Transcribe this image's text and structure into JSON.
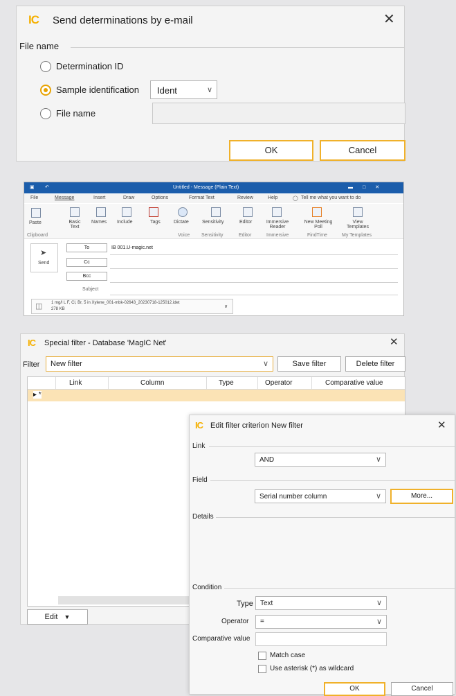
{
  "send_dialog": {
    "logo": "IC",
    "title": "Send determinations by e-mail",
    "close": "✕",
    "group_label": "File name",
    "option_determination_id": "Determination ID",
    "option_sample_identification": "Sample identification",
    "sample_select_value": "Ident",
    "option_file_name": "File name",
    "ok_label": "OK",
    "cancel_label": "Cancel"
  },
  "outlook": {
    "window_title": "Untitled - Message (Plain Text)",
    "menu": [
      "File",
      "Message",
      "Insert",
      "Draw",
      "Options",
      "Format Text",
      "Review",
      "Help"
    ],
    "tell_me": "Tell me what you want to do",
    "ribbon": {
      "paste": "Paste",
      "basic_text": "Basic Text",
      "names": "Names",
      "include": "Include",
      "tags": "Tags",
      "dictate": "Dictate",
      "sensitivity": "Sensitivity",
      "editor": "Editor",
      "immersive_reader": "Immersive Reader",
      "new_meeting_poll": "New Meeting Poll",
      "view_templates": "View Templates"
    },
    "groups": [
      "Clipboard",
      "Voice",
      "Sensitivity",
      "Editor",
      "Immersive",
      "FindTime",
      "My Templates"
    ],
    "send_label": "Send",
    "to_label": "To",
    "cc_label": "Cc",
    "bcc_label": "Bcc",
    "subject_label": "Subject",
    "to_value": "IB 001.U-magic.net",
    "attachment_name": "1 mg/l L F, Cl, Br, 5 in Xylene_001-mbk-02643_20230718-125012.idet",
    "attachment_size": "278 KB"
  },
  "special_filter": {
    "logo": "IC",
    "title": "Special filter - Database 'MagIC Net'",
    "close": "✕",
    "filter_label": "Filter",
    "filter_value": "New filter",
    "save_filter": "Save filter",
    "delete_filter": "Delete filter",
    "columns": [
      "Link",
      "Column",
      "Type",
      "Operator",
      "Comparative value"
    ],
    "row_marker": "▸ *",
    "edit_label": "Edit"
  },
  "edit_criterion": {
    "logo": "IC",
    "title": "Edit filter criterion New filter",
    "close": "✕",
    "link_label": "Link",
    "link_value": "AND",
    "field_label": "Field",
    "field_value": "Serial number column",
    "more_button": "More...",
    "details_label": "Details",
    "condition_label": "Condition",
    "type_label": "Type",
    "type_value": "Text",
    "operator_label": "Operator",
    "operator_value": "=",
    "comparative_label": "Comparative value",
    "comparative_value": "",
    "match_case": "Match case",
    "use_asterisk": "Use asterisk (*) as wildcard",
    "ok_label": "OK",
    "cancel_label": "Cancel"
  },
  "colors": {
    "accent": "#F5B000",
    "outlook_blue": "#1B5DAB",
    "selected_row": "#FBE3B5"
  }
}
